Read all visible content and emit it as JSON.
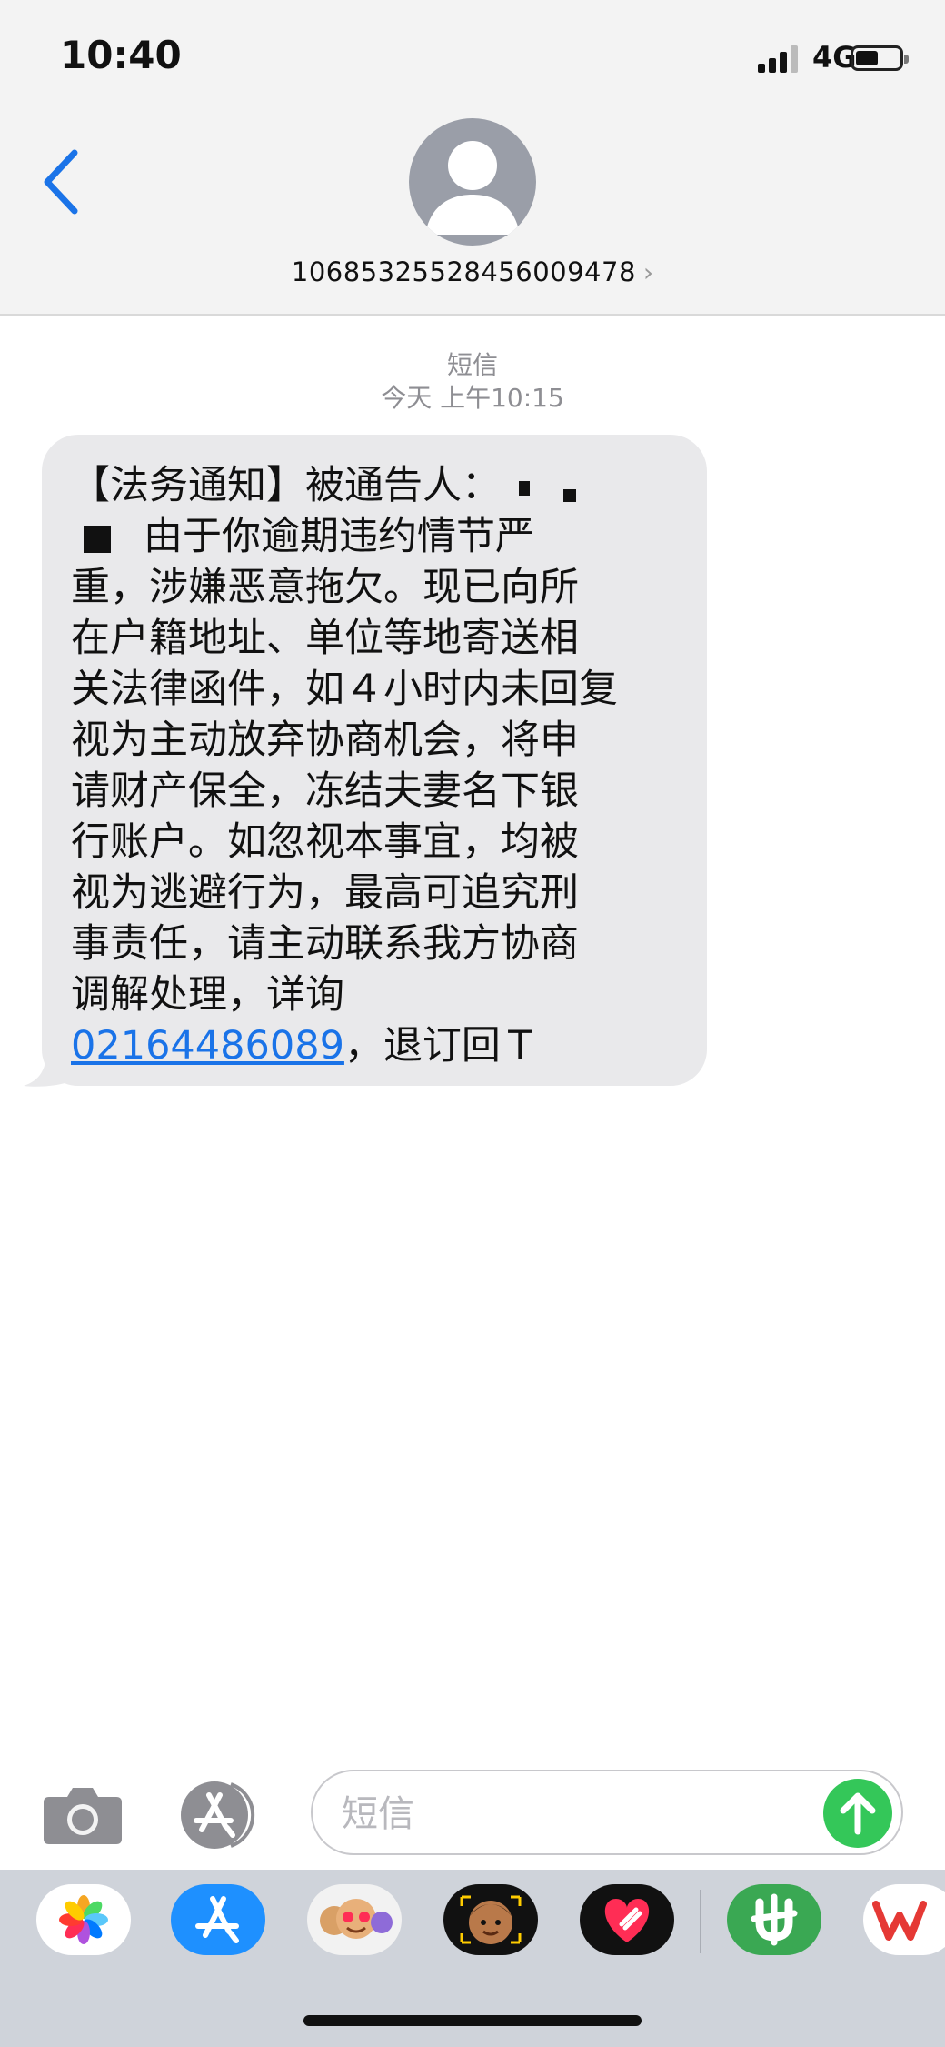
{
  "status_bar": {
    "time": "10:40",
    "network": "4G"
  },
  "header": {
    "contact_number": "10685325528456009478"
  },
  "conversation": {
    "service_label": "短信",
    "timestamp": "今天 上午10:15",
    "message": {
      "line1": "【法务通知】被通告人：",
      "line2": "由于你逾期违约情节严",
      "line3": "重，涉嫌恶意拖欠。现已向所",
      "line4": "在户籍地址、单位等地寄送相",
      "line5": "关法律函件，如４小时内未回复",
      "line6": "视为主动放弃协商机会，将申",
      "line7": "请财产保全，冻结夫妻名下银",
      "line8": "行账户。如忽视本事宜，均被",
      "line9": "视为逃避行为，最高可追究刑",
      "line10": "事责任，请主动联系我方协商",
      "line11": "调解处理，详询",
      "phone": "02164486089",
      "tail": "，退订回Ｔ"
    }
  },
  "composer": {
    "placeholder": "短信"
  },
  "app_drawer": {
    "apps": [
      "photos-app",
      "app-store-app",
      "memoji-stickers-app",
      "animoji-app",
      "digital-touch-app",
      "green-app",
      "wps-office-app"
    ]
  },
  "colors": {
    "accent": "#1a73e8",
    "send": "#34c759",
    "bubble": "#e9e9eb"
  }
}
